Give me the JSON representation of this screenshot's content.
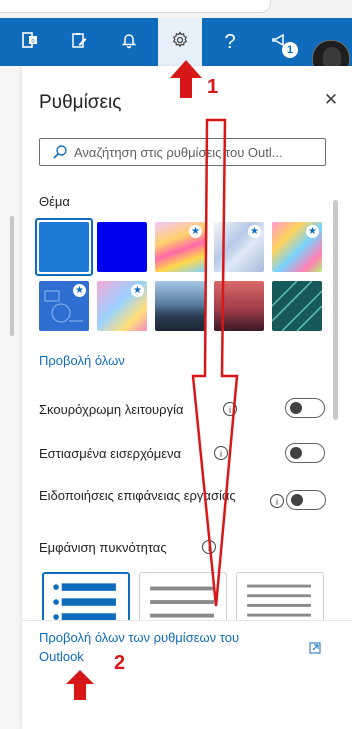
{
  "toolbar": {
    "buttons": [
      {
        "name": "office-apps",
        "icon": "office-icon"
      },
      {
        "name": "clipboard-note",
        "icon": "clipboard-icon"
      },
      {
        "name": "notifications",
        "icon": "bell-icon"
      },
      {
        "name": "settings",
        "icon": "gear-icon",
        "active": true
      },
      {
        "name": "help",
        "icon": "question-icon",
        "label": "?"
      },
      {
        "name": "feedback",
        "icon": "megaphone-icon"
      }
    ],
    "feedback_badge": "1",
    "accent": "#0f6cbd"
  },
  "panel": {
    "title": "Ρυθμίσεις",
    "close_glyph": "✕",
    "search_placeholder": "Αναζήτηση στις ρυθμίσεις του Outl..."
  },
  "theme": {
    "label": "Θέμα",
    "view_all": "Προβολή όλων",
    "star_glyph": "★"
  },
  "settings": {
    "dark_mode": {
      "label": "Σκουρόχρωμη λειτουργία",
      "info": "i",
      "on": false
    },
    "focused_inbox": {
      "label": "Εστιασμένα εισερχόμενα",
      "info": "i",
      "on": false
    },
    "desktop_notifications": {
      "label": "Ειδοποιήσεις επιφάνειας εργασίας",
      "info": "i",
      "on": false
    },
    "density": {
      "label": "Εμφάνιση πυκνότητας",
      "info": "i"
    }
  },
  "footer": {
    "link_line1": "Προβολή όλων των ρυθμίσεων του",
    "link_line2": "Outlook"
  },
  "annotations": {
    "step1": "1",
    "step2": "2",
    "color": "#d81818"
  }
}
